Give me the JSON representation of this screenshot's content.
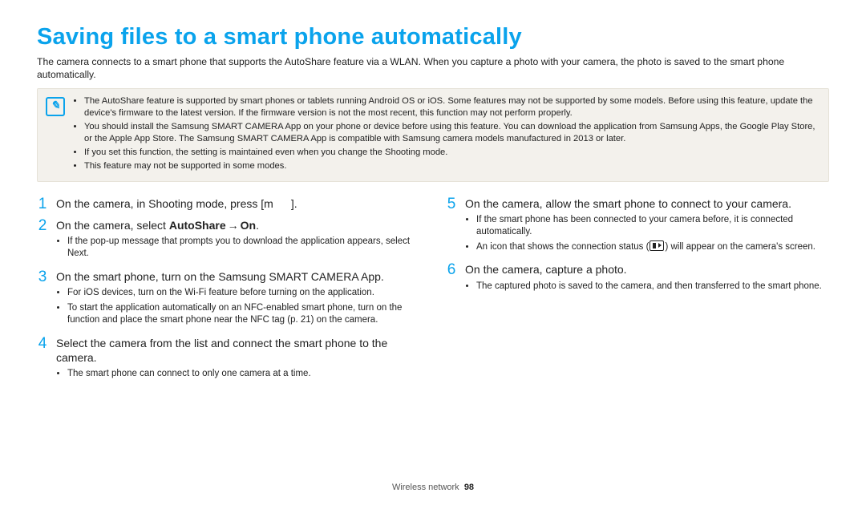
{
  "title": "Saving files to a smart phone automatically",
  "intro": "The camera connects to a smart phone that supports the AutoShare feature via a WLAN. When you capture a photo with your camera, the photo is saved to the smart phone automatically.",
  "note_icon_glyph": "✎",
  "notes": [
    "The AutoShare feature is supported by smart phones or tablets running Android OS or iOS. Some features may not be supported by some models. Before using this feature, update the device's firmware to the latest version. If the firmware version is not the most recent, this function may not perform properly.",
    "You should install the Samsung SMART CAMERA App on your phone or device before using this feature. You can download the application from Samsung Apps, the Google Play Store, or the Apple App Store. The Samsung SMART CAMERA App is compatible with Samsung camera models manufactured in 2013 or later.",
    "If you set this function, the setting is maintained even when you change the Shooting mode.",
    "This feature may not be supported in some modes."
  ],
  "steps": {
    "s1": {
      "pre": "On the camera, in Shooting mode, press [",
      "glyph": "m",
      "post": "]."
    },
    "s2": {
      "pre": "On the camera, select ",
      "b1": "AutoShare",
      "arrow": "→",
      "b2": "On",
      "post": ".",
      "sub1a": "If the pop-up message that prompts you to download the application appears, select ",
      "sub1_bold": "Next",
      "sub1b": "."
    },
    "s3": {
      "text": "On the smart phone, turn on the Samsung SMART CAMERA App.",
      "sub1": "For iOS devices, turn on the Wi-Fi feature before turning on the application.",
      "sub2": "To start the application automatically on an NFC-enabled smart phone, turn on the function and place the smart phone near the NFC tag (p. 21) on the camera."
    },
    "s4": {
      "text": "Select the camera from the list and connect the smart phone to the camera.",
      "sub1": "The smart phone can connect to only one camera at a time."
    },
    "s5": {
      "text": "On the camera, allow the smart phone to connect to your camera.",
      "sub1": "If the smart phone has been connected to your camera before, it is connected automatically.",
      "sub2a": "An icon that shows the connection status (",
      "sub2b": ") will appear on the camera's screen."
    },
    "s6": {
      "text": "On the camera, capture a photo.",
      "sub1": "The captured photo is saved to the camera, and then transferred to the smart phone."
    }
  },
  "footer_label": "Wireless network",
  "footer_page": "98"
}
